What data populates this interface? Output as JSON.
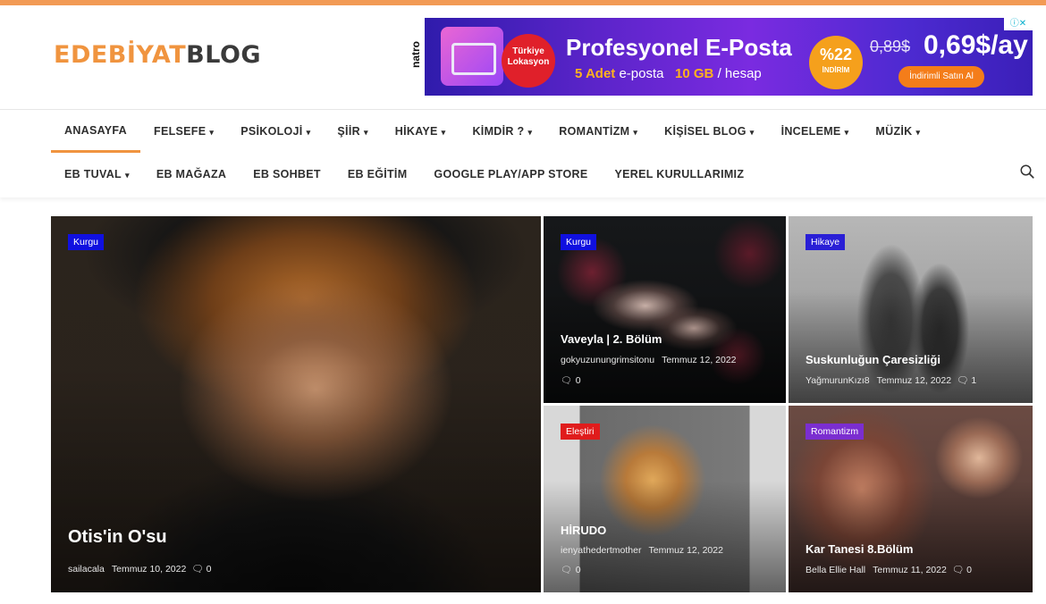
{
  "logo": {
    "part1": "EDEBİYAT",
    "part2": "BLOG"
  },
  "ad": {
    "brand": "natro",
    "location": "Türkiye Lokasyon",
    "title": "Profesyonel E-Posta",
    "sub_count": "5 Adet",
    "sub_text1": "e-posta",
    "sub_size": "10 GB",
    "sub_text2": "/ hesap",
    "discount": "%22",
    "discount_label": "İNDİRİM",
    "old_price": "0,89$",
    "new_price": "0,69$/ay",
    "cta": "İndirimli Satın Al",
    "close": "ⓘ✕"
  },
  "nav": {
    "row1": [
      {
        "label": "ANASAYFA",
        "caret": "",
        "active": true
      },
      {
        "label": "FELSEFE",
        "caret": "▾"
      },
      {
        "label": "PSİKOLOJİ",
        "caret": "▾"
      },
      {
        "label": "ŞİİR",
        "caret": "▾"
      },
      {
        "label": "HİKAYE",
        "caret": "▾"
      },
      {
        "label": "KİMDİR ?",
        "caret": "▾"
      },
      {
        "label": "ROMANTİZM",
        "caret": "▾"
      },
      {
        "label": "KİŞİSEL BLOG",
        "caret": "▾"
      },
      {
        "label": "İNCELEME",
        "caret": "▾"
      },
      {
        "label": "MÜZİK",
        "caret": "▾"
      }
    ],
    "row2": [
      {
        "label": "EB TUVAL",
        "caret": "▾"
      },
      {
        "label": "EB MAĞAZA",
        "caret": ""
      },
      {
        "label": "EB SOHBET",
        "caret": ""
      },
      {
        "label": "EB EĞİTİM",
        "caret": ""
      },
      {
        "label": "GOOGLE PLAY/APP STORE",
        "caret": ""
      },
      {
        "label": "YEREL KURULLARIMIZ",
        "caret": ""
      }
    ]
  },
  "colors": {
    "accent": "#f0943f",
    "badge_kurgu": "#1010e0",
    "badge_hikaye": "#2a1fd6",
    "badge_elestiri": "#e01c1c",
    "badge_romantizm": "#7b2ed0"
  },
  "posts": [
    {
      "category": "Kurgu",
      "title": "Otis'in O'su",
      "author": "sailacala",
      "date": "Temmuz 10, 2022",
      "comments": "0"
    },
    {
      "category": "Kurgu",
      "title": "Vaveyla | 2. Bölüm",
      "author": "gokyuzunungrimsitonu",
      "date": "Temmuz 12, 2022",
      "comments": "0"
    },
    {
      "category": "Hikaye",
      "title": "Suskunluğun Çaresizliği",
      "author": "YağmurunKızı8",
      "date": "Temmuz 12, 2022",
      "comments": "1"
    },
    {
      "category": "Eleştiri",
      "title": "HİRUDO",
      "author": "ienyathedertmother",
      "date": "Temmuz 12, 2022",
      "comments": "0"
    },
    {
      "category": "Romantizm",
      "title": "Kar Tanesi 8.Bölüm",
      "author": "Bella Ellie Hall",
      "date": "Temmuz 11, 2022",
      "comments": "0"
    }
  ]
}
